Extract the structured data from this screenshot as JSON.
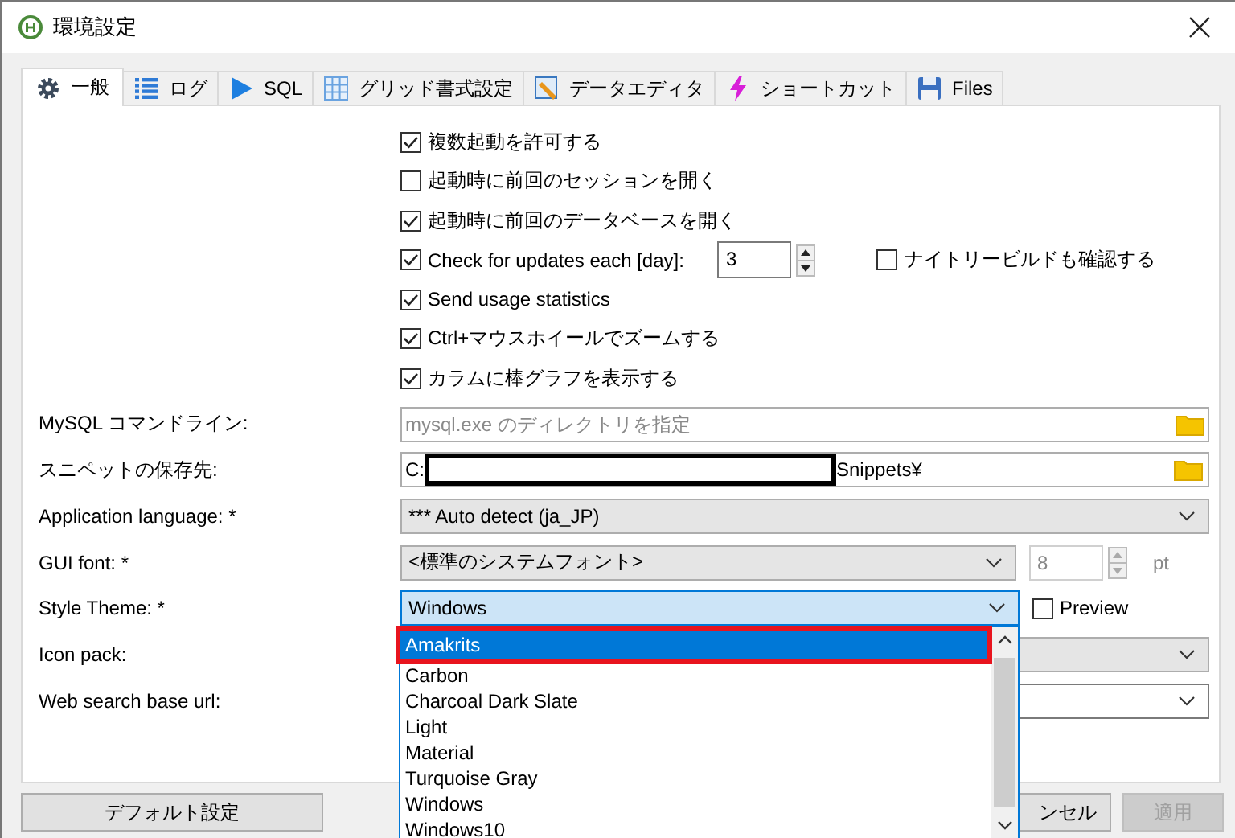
{
  "window": {
    "title": "環境設定"
  },
  "tabs": [
    {
      "label": "一般",
      "selected": true
    },
    {
      "label": "ログ",
      "selected": false
    },
    {
      "label": "SQL",
      "selected": false
    },
    {
      "label": "グリッド書式設定",
      "selected": false
    },
    {
      "label": "データエディタ",
      "selected": false
    },
    {
      "label": "ショートカット",
      "selected": false
    },
    {
      "label": "Files",
      "selected": false
    }
  ],
  "checks": [
    {
      "kind": "check",
      "label": "複数起動を許可する",
      "checked": true
    },
    {
      "kind": "check",
      "label": "起動時に前回のセッションを開く",
      "checked": false
    },
    {
      "kind": "check",
      "label": "起動時に前回のデータベースを開く",
      "checked": true
    },
    {
      "kind": "check_spin",
      "label": "Check for updates each [day]:",
      "checked": true,
      "spin_value": "3",
      "extra": {
        "label": "ナイトリービルドも確認する",
        "checked": false
      }
    },
    {
      "kind": "check",
      "label": "Send usage statistics",
      "checked": true
    },
    {
      "kind": "check",
      "label": "Ctrl+マウスホイールでズームする",
      "checked": true
    },
    {
      "kind": "check",
      "label": "カラムに棒グラフを表示する",
      "checked": true
    }
  ],
  "fields": [
    {
      "kind": "path",
      "label": "MySQL コマンドライン:",
      "placeholder": "mysql.exe のディレクトリを指定"
    },
    {
      "kind": "path",
      "label": "スニペットの保存先:",
      "value_parts": [
        "C:",
        "Snippets¥"
      ],
      "redacted": true
    },
    {
      "kind": "combo",
      "label": "Application language: *",
      "value": "*** Auto detect (ja_JP)",
      "editable": false
    },
    {
      "kind": "font",
      "label": "GUI font: *",
      "value": "<標準のシステムフォント>",
      "size": "8",
      "unit": "pt",
      "size_disabled": true
    },
    {
      "kind": "theme",
      "label": "Style Theme: *",
      "value": "Windows",
      "focused": true,
      "preview": {
        "label": "Preview",
        "checked": false
      }
    },
    {
      "kind": "combo",
      "label": "Icon pack:",
      "editable": false
    },
    {
      "kind": "combo",
      "label": "Web search base url:",
      "editable": true
    }
  ],
  "dropdown": {
    "options": [
      {
        "label": "Amakrits",
        "selected": true,
        "annotated": true
      },
      {
        "label": "Carbon",
        "selected": false,
        "annotated": false
      },
      {
        "label": "Charcoal Dark Slate",
        "selected": false,
        "annotated": false
      },
      {
        "label": "Light",
        "selected": false,
        "annotated": false
      },
      {
        "label": "Material",
        "selected": false,
        "annotated": false
      },
      {
        "label": "Turquoise Gray",
        "selected": false,
        "annotated": false
      },
      {
        "label": "Windows",
        "selected": false,
        "annotated": false
      },
      {
        "label": "Windows10",
        "selected": false,
        "annotated": false
      }
    ]
  },
  "buttons": [
    {
      "kind": "default",
      "label": "デフォルト設定",
      "disabled": false
    },
    {
      "kind": "cancel",
      "label": "ンセル",
      "disabled": false
    },
    {
      "kind": "apply",
      "label": "適用",
      "disabled": true
    }
  ]
}
